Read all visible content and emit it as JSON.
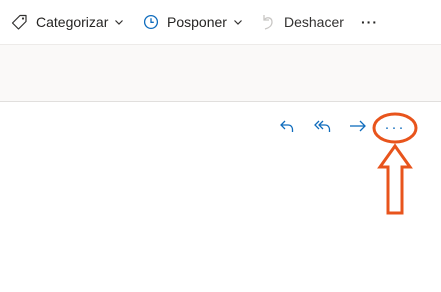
{
  "toolbar": {
    "categorize_label": "Categorizar",
    "snooze_label": "Posponer",
    "undo_label": "Deshacer",
    "overflow_label": "···",
    "icons": {
      "categorize": "tag-icon",
      "snooze": "clock-icon",
      "undo": "undo-icon"
    }
  },
  "reading_pane": {
    "actions": [
      {
        "name": "reply",
        "icon": "reply-icon"
      },
      {
        "name": "reply-all",
        "icon": "reply-all-icon"
      },
      {
        "name": "forward",
        "icon": "forward-icon"
      }
    ],
    "more_label": "···"
  },
  "colors": {
    "accent": "#0f6cbd",
    "annotation": "#e8541c",
    "toolbar_bg": "#ffffff",
    "page_bg": "#faf9f8"
  }
}
